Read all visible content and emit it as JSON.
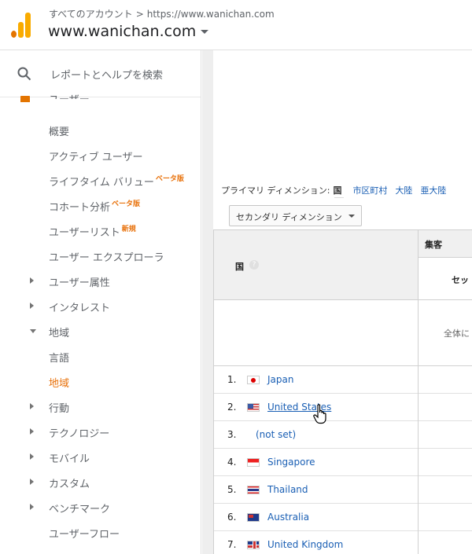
{
  "header": {
    "breadcrumb_root": "すべてのアカウント",
    "breadcrumb_sep": ">",
    "breadcrumb_url": "https://www.wanichan.com",
    "account_name": "www.wanichan.com"
  },
  "sidebar": {
    "search_label": "レポートとヘルプを検索",
    "section_title": "ユーザー",
    "items": [
      {
        "label": "概要",
        "badge": ""
      },
      {
        "label": "アクティブ ユーザー",
        "badge": ""
      },
      {
        "label": "ライフタイム バリュー",
        "badge": "ベータ版"
      },
      {
        "label": "コホート分析",
        "badge": "ベータ版"
      },
      {
        "label": "ユーザーリスト",
        "badge": "新規"
      },
      {
        "label": "ユーザー エクスプローラ",
        "badge": ""
      },
      {
        "label": "ユーザー属性",
        "badge": ""
      },
      {
        "label": "インタレスト",
        "badge": ""
      },
      {
        "label": "地域",
        "badge": ""
      },
      {
        "label": "言語",
        "badge": ""
      },
      {
        "label": "地域",
        "badge": ""
      },
      {
        "label": "行動",
        "badge": ""
      },
      {
        "label": "テクノロジー",
        "badge": ""
      },
      {
        "label": "モバイル",
        "badge": ""
      },
      {
        "label": "カスタム",
        "badge": ""
      },
      {
        "label": "ベンチマーク",
        "badge": ""
      },
      {
        "label": "ユーザーフロー",
        "badge": ""
      }
    ]
  },
  "dimension": {
    "label": "プライマリ ディメンション:",
    "current": "国",
    "options": [
      "市区町村",
      "大陸",
      "亜大陸"
    ]
  },
  "secondary_button": "セカンダリ ディメンション",
  "table": {
    "col_country": "国",
    "help": "?",
    "col_group": "集客",
    "col_session": "セッ",
    "total_label": "全体に",
    "rows": [
      {
        "num": "1.",
        "country": "Japan"
      },
      {
        "num": "2.",
        "country": "United States"
      },
      {
        "num": "3.",
        "country": "(not set)"
      },
      {
        "num": "4.",
        "country": "Singapore"
      },
      {
        "num": "5.",
        "country": "Thailand"
      },
      {
        "num": "6.",
        "country": "Australia"
      },
      {
        "num": "7.",
        "country": "United Kingdom"
      }
    ]
  },
  "colors": {
    "accent_orange": "#e8710a",
    "link_blue": "#1a5fb4",
    "logo_orange": "#f9ab00"
  }
}
